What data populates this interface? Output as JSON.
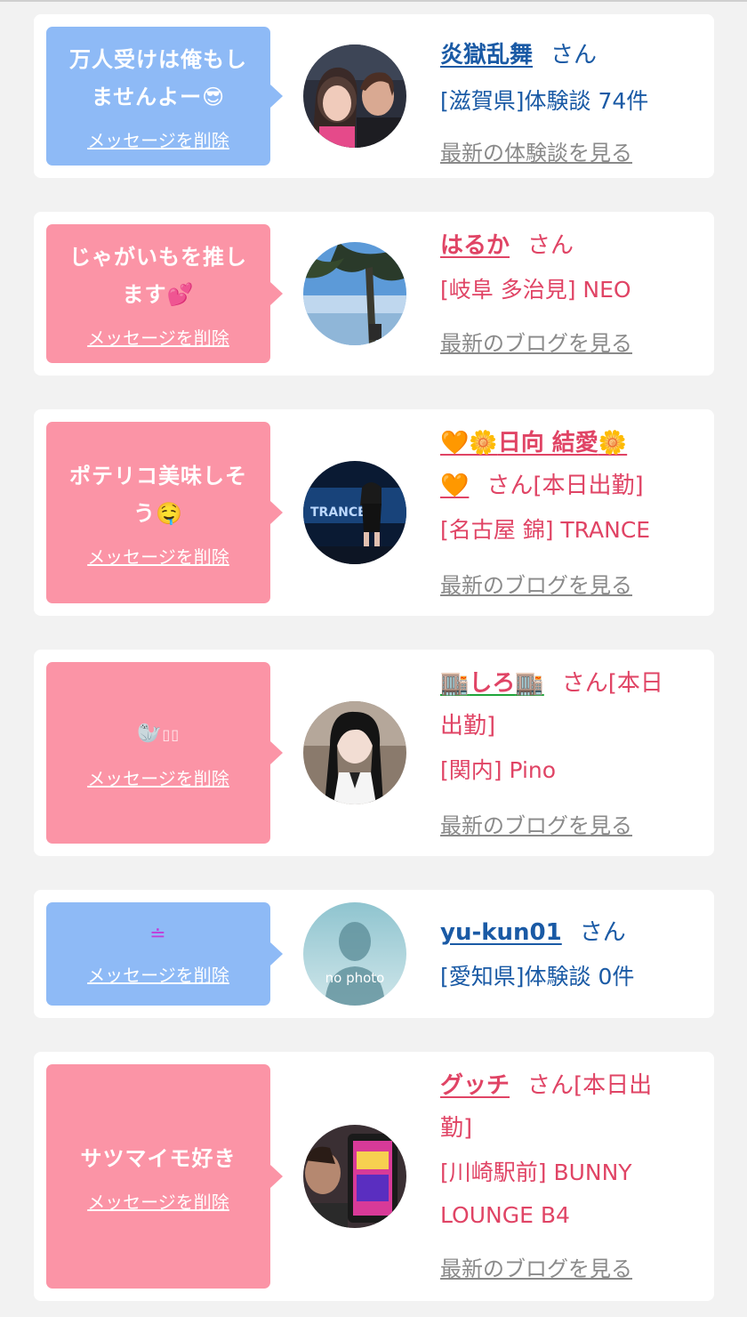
{
  "messages": [
    {
      "bubble_color": "#8ebaf6",
      "message_line1": "万人受けは俺もし",
      "message_line2": "ませんよー",
      "message_emoji": "😎",
      "delete_label": "メッセージを削除",
      "name": "炎獄乱舞",
      "honorific": "さん",
      "location": "[滋賀県]体験談 74件",
      "more_link": "最新の体験談を見る",
      "name_color": "#1a5aa5"
    },
    {
      "bubble_color": "#fb94a6",
      "message_line1": "じゃがいもを推し",
      "message_line2": "ます",
      "message_emoji": "💕",
      "delete_label": "メッセージを削除",
      "name": "はるか",
      "honorific": "さん",
      "location": "[岐阜 多治見] NEO",
      "more_link": "最新のブログを見る",
      "name_color": "#e04465"
    },
    {
      "bubble_color": "#fb94a6",
      "message_line1": "ポテリコ美味しそ",
      "message_line2": "う",
      "message_emoji": "🤤",
      "delete_label": "メッセージを削除",
      "name_prefix_emoji": "🧡🌼",
      "name": "日向 結愛",
      "name_suffix_emoji": "🌼",
      "name_tail_emoji": "🧡",
      "honorific": "さん[本日出勤]",
      "location": "[名古屋 錦] TRANCE",
      "more_link": "最新のブログを見る",
      "name_color": "#e04465"
    },
    {
      "bubble_color": "#fb94a6",
      "message_emoji": "🦭",
      "message_after_emoji": "▯▯",
      "delete_label": "メッセージを削除",
      "name_prefix_emoji": "🏬",
      "name": "しろ",
      "name_suffix_emoji": "🏬",
      "honorific": "さん[本日",
      "honorific_line2": "出勤]",
      "location": "[関内] Pino",
      "more_link": "最新のブログを見る",
      "name_color": "#e04465"
    },
    {
      "bubble_color": "#8ebaf6",
      "message_line1": "≐",
      "delete_label": "メッセージを削除",
      "name": "yu-kun01",
      "honorific": "さん",
      "location": "[愛知県]体験談 0件",
      "avatar_text": "no photo",
      "name_color": "#1a5aa5"
    },
    {
      "bubble_color": "#fb94a6",
      "message_line1": "サツマイモ好き",
      "delete_label": "メッセージを削除",
      "name": "グッチ",
      "honorific": "さん[本日出",
      "honorific_line2": "勤]",
      "location": "[川崎駅前] BUNNY",
      "location_line2": "LOUNGE B4",
      "more_link": "最新のブログを見る",
      "name_color": "#e04465"
    }
  ]
}
